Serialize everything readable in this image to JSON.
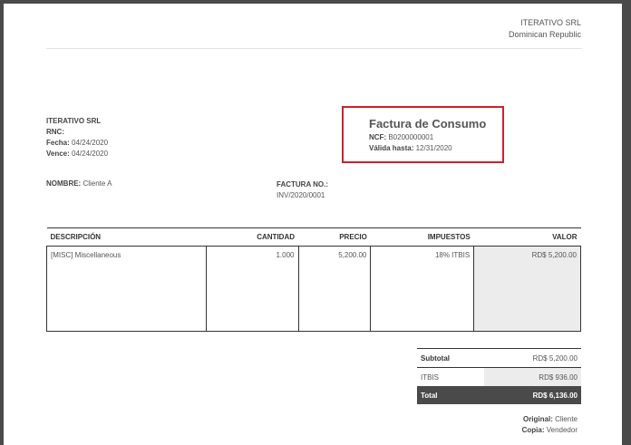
{
  "company": {
    "name": "ITERATIVO SRL",
    "country": "Dominican Republic"
  },
  "issuer": {
    "name": "ITERATIVO SRL",
    "rnc_label": "RNC:",
    "fecha_label": "Fecha:",
    "fecha": "04/24/2020",
    "vence_label": "Vence:",
    "vence": "04/24/2020"
  },
  "doc": {
    "title": "Factura de Consumo",
    "ncf_label": "NCF:",
    "ncf": "B0200000001",
    "valida_label": "Válida hasta:",
    "valida": "12/31/2020"
  },
  "customer": {
    "nombre_label": "NOMBRE:",
    "nombre": "Cliente A"
  },
  "invoice": {
    "no_label": "FACTURA NO.:",
    "no": "INV/2020/0001"
  },
  "table": {
    "headers": [
      "DESCRIPCIÓN",
      "CANTIDAD",
      "PRECIO",
      "IMPUESTOS",
      "VALOR"
    ],
    "rows": [
      [
        "[MISC] Miscellaneous",
        "1.000",
        "5,200.00",
        "18% ITBIS",
        "RD$ 5,200.00"
      ]
    ]
  },
  "totals": {
    "subtotal_label": "Subtotal",
    "subtotal": "RD$ 5,200.00",
    "tax_label": "ITBIS",
    "tax": "RD$ 936.00",
    "total_label": "Total",
    "total": "RD$ 6,136.00"
  },
  "footer": {
    "original_label": "Original:",
    "original": "Cliente",
    "copia_label": "Copia:",
    "copia": "Vendedor"
  },
  "colors": {
    "highlight_border": "#d0212b",
    "total_bg": "#4a4a4a",
    "valor_bg": "#ececec"
  }
}
